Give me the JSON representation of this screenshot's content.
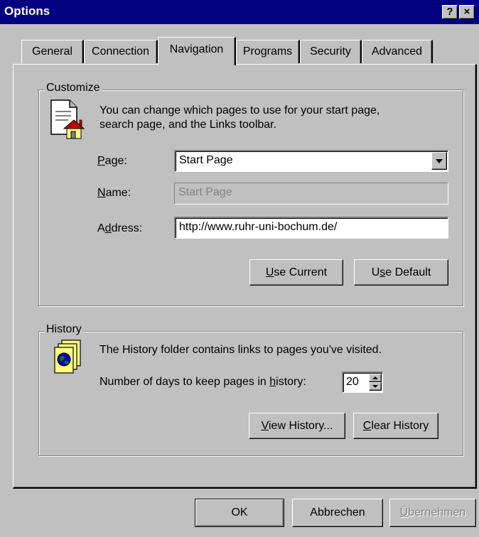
{
  "window": {
    "title": "Options",
    "help_button": "?",
    "close_button": "×"
  },
  "tabs": [
    {
      "label": "General",
      "active": false
    },
    {
      "label": "Connection",
      "active": false
    },
    {
      "label": "Navigation",
      "active": true
    },
    {
      "label": "Programs",
      "active": false
    },
    {
      "label": "Security",
      "active": false
    },
    {
      "label": "Advanced",
      "active": false
    }
  ],
  "customize": {
    "legend": "Customize",
    "description_line1": "You can change which pages to use for your start page,",
    "description_line2": "search page, and the Links toolbar.",
    "page_label_mnemonic": "P",
    "page_label_rest": "age:",
    "page_value": "Start Page",
    "name_label_mnemonic": "N",
    "name_label_rest": "ame:",
    "name_value": "Start Page",
    "address_label_pre": "A",
    "address_label_mnemonic": "d",
    "address_label_rest": "dress:",
    "address_value": "http://www.ruhr-uni-bochum.de/",
    "use_current_mnemonic": "U",
    "use_current_rest": "se Current",
    "use_default_pre": "U",
    "use_default_mnemonic": "s",
    "use_default_rest": "e Default"
  },
  "history": {
    "legend": "History",
    "description": "The History folder contains links to pages you've visited.",
    "days_label_pre": "Number of days to keep pages in ",
    "days_label_mnemonic": "h",
    "days_label_rest": "istory:",
    "days_value": "20",
    "view_history_mnemonic": "V",
    "view_history_rest": "iew History...",
    "clear_history_mnemonic": "C",
    "clear_history_rest": "lear History"
  },
  "footer": {
    "ok": "OK",
    "cancel": "Abbrechen",
    "apply_mnemonic": "Ü",
    "apply_rest": "bernehmen"
  },
  "icons": {
    "customize_icon": "document-home-icon",
    "history_icon": "history-folder-globe-icon"
  }
}
